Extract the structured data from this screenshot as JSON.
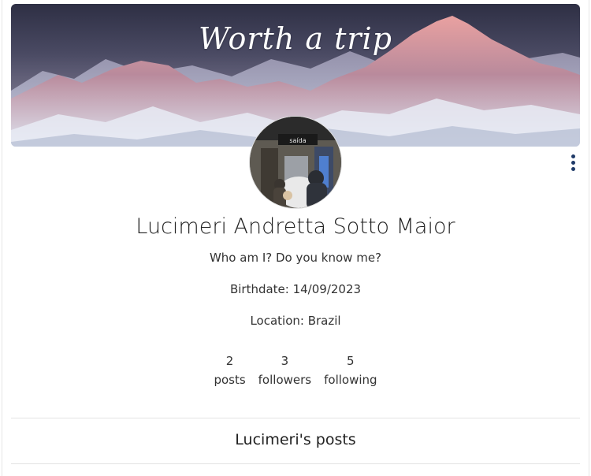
{
  "cover": {
    "title": "Worth a trip",
    "image": "mountain-range-sunset"
  },
  "profile": {
    "name": "Lucimeri Andretta Sotto Maior",
    "bio": "Who am I? Do you know me?",
    "birthdate": "Birthdate: 14/09/2023",
    "location": "Location: Brazil",
    "avatar": "hallway-photo",
    "avatar_sign": "saída"
  },
  "stats": [
    {
      "value": "2",
      "label": "posts"
    },
    {
      "value": "3",
      "label": "followers"
    },
    {
      "value": "5",
      "label": "following"
    }
  ],
  "posts_section": {
    "title": "Lucimeri's posts"
  },
  "menu": {
    "icon": "more-vertical-icon"
  },
  "colors": {
    "accent": "#1f3a68"
  }
}
